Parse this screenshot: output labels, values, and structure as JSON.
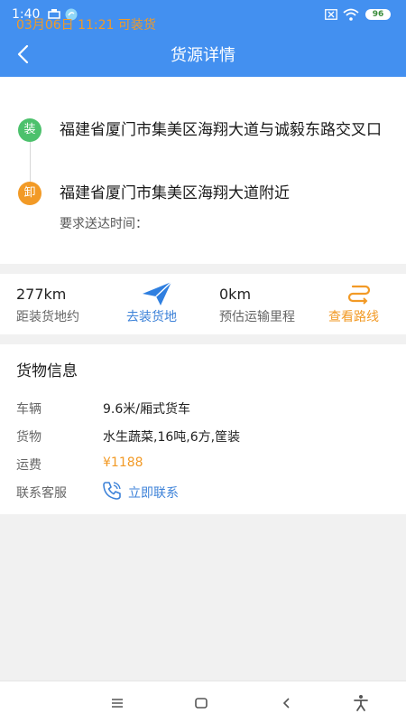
{
  "status_bar": {
    "time": "1:40",
    "battery": "96"
  },
  "header": {
    "title": "货源详情"
  },
  "shipment": {
    "date_status": "03月06日 11:21 可装货",
    "load_badge": "装",
    "load_address": "福建省厦门市集美区海翔大道与诚毅东路交叉口",
    "unload_badge": "卸",
    "unload_address": "福建省厦门市集美区海翔大道附近",
    "delivery_time_label": "要求送达时间："
  },
  "distance": {
    "to_load_value": "277km",
    "to_load_label": "距装货地约",
    "go_load_label": "去装货地",
    "est_value": "0km",
    "est_label": "预估运输里程",
    "view_route_label": "查看路线"
  },
  "cargo": {
    "section_title": "货物信息",
    "rows": [
      {
        "label": "车辆",
        "value": "9.6米/厢式货车"
      },
      {
        "label": "货物",
        "value": "水生蔬菜,16吨,6方,筐装"
      },
      {
        "label": "运费",
        "value": "¥1188"
      }
    ],
    "contact_label": "联系客服",
    "contact_action": "立即联系"
  },
  "colors": {
    "primary": "#4390f0",
    "accent": "#f29a26",
    "load": "#4cc16c",
    "link": "#3d82d8"
  },
  "icons": [
    "back-arrow-icon",
    "paper-plane-icon",
    "route-icon",
    "phone-icon",
    "menu-icon",
    "home-icon",
    "nav-back-icon",
    "accessibility-icon"
  ]
}
